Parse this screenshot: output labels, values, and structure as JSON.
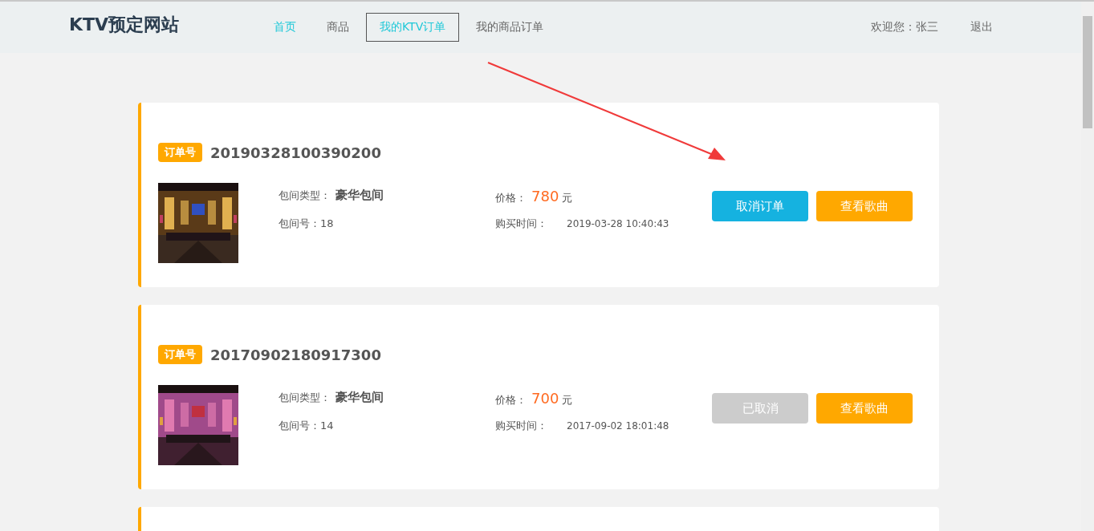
{
  "header": {
    "logo": "KTV预定网站",
    "nav": [
      {
        "label": "首页",
        "active": true,
        "selected": false
      },
      {
        "label": "商品",
        "active": false,
        "selected": false
      },
      {
        "label": "我的KTV订单",
        "active": true,
        "selected": true
      },
      {
        "label": "我的商品订单",
        "active": false,
        "selected": false
      }
    ],
    "welcome": "欢迎您：张三",
    "logout": "退出"
  },
  "orders": [
    {
      "badge": "订单号",
      "number": "20190328100390200",
      "type_label": "包间类型：",
      "type_value": "豪华包间",
      "room_label": "包间号：18",
      "price_label": "价格：",
      "price_value": "780",
      "price_unit": "元",
      "time_label": "购买时间：",
      "time_value": "2019-03-28 10:40:43",
      "cancel": {
        "label": "取消订单",
        "disabled": false
      },
      "songs": {
        "label": "查看歌曲"
      }
    },
    {
      "badge": "订单号",
      "number": "20170902180917300",
      "type_label": "包间类型：",
      "type_value": "豪华包间",
      "room_label": "包间号：14",
      "price_label": "价格：",
      "price_value": "700",
      "price_unit": "元",
      "time_label": "购买时间：",
      "time_value": "2017-09-02 18:01:48",
      "cancel": {
        "label": "已取消",
        "disabled": true
      },
      "songs": {
        "label": "查看歌曲"
      }
    }
  ]
}
